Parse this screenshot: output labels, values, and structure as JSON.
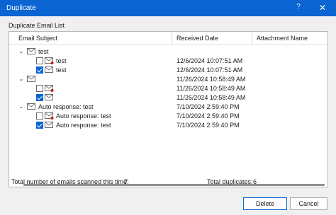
{
  "window": {
    "title": "Duplicate",
    "help": "?",
    "close": "✕"
  },
  "group_label": "Duplicate Email List",
  "columns": {
    "subject": "Email Subject",
    "received": "Received Date",
    "attachment": "Attachment Name"
  },
  "rows": [
    {
      "level": 0,
      "expanded": true,
      "checkbox": false,
      "checked": false,
      "unread": false,
      "subject": "test",
      "received": ""
    },
    {
      "level": 1,
      "checkbox": true,
      "checked": false,
      "unread": true,
      "subject": "test",
      "received": "12/6/2024 10:07:51 AM"
    },
    {
      "level": 1,
      "checkbox": true,
      "checked": true,
      "unread": false,
      "subject": "test",
      "received": "12/6/2024 10:07:51 AM"
    },
    {
      "level": 0,
      "expanded": true,
      "checkbox": false,
      "checked": false,
      "unread": false,
      "subject": "",
      "received": "11/26/2024 10:58:49 AM"
    },
    {
      "level": 1,
      "checkbox": true,
      "checked": false,
      "unread": true,
      "subject": "",
      "received": "11/26/2024 10:58:49 AM"
    },
    {
      "level": 1,
      "checkbox": true,
      "checked": true,
      "unread": false,
      "subject": "",
      "received": "11/26/2024 10:58:49 AM"
    },
    {
      "level": 0,
      "expanded": true,
      "checkbox": false,
      "checked": false,
      "unread": false,
      "subject": "Auto response: test",
      "received": "7/10/2024 2:59:40 PM"
    },
    {
      "level": 1,
      "checkbox": true,
      "checked": false,
      "unread": true,
      "subject": "Auto response: test",
      "received": "7/10/2024 2:59:40 PM"
    },
    {
      "level": 1,
      "checkbox": true,
      "checked": true,
      "unread": false,
      "subject": "Auto response: test",
      "received": "7/10/2024 2:59:40 PM"
    }
  ],
  "stats": {
    "scanned_label": "Total number of emails scanned this time:",
    "scanned_value": "7",
    "duplicates_label": "Total duplicates:",
    "duplicates_value": "6"
  },
  "buttons": {
    "delete": "Delete",
    "cancel": "Cancel"
  },
  "icons": {
    "expander": "chevron-down-icon",
    "envelope": "envelope-icon",
    "unread": "unread-dot-icon"
  },
  "colors": {
    "accent": "#0a64d2",
    "unread_dot": "#c41e1e"
  }
}
